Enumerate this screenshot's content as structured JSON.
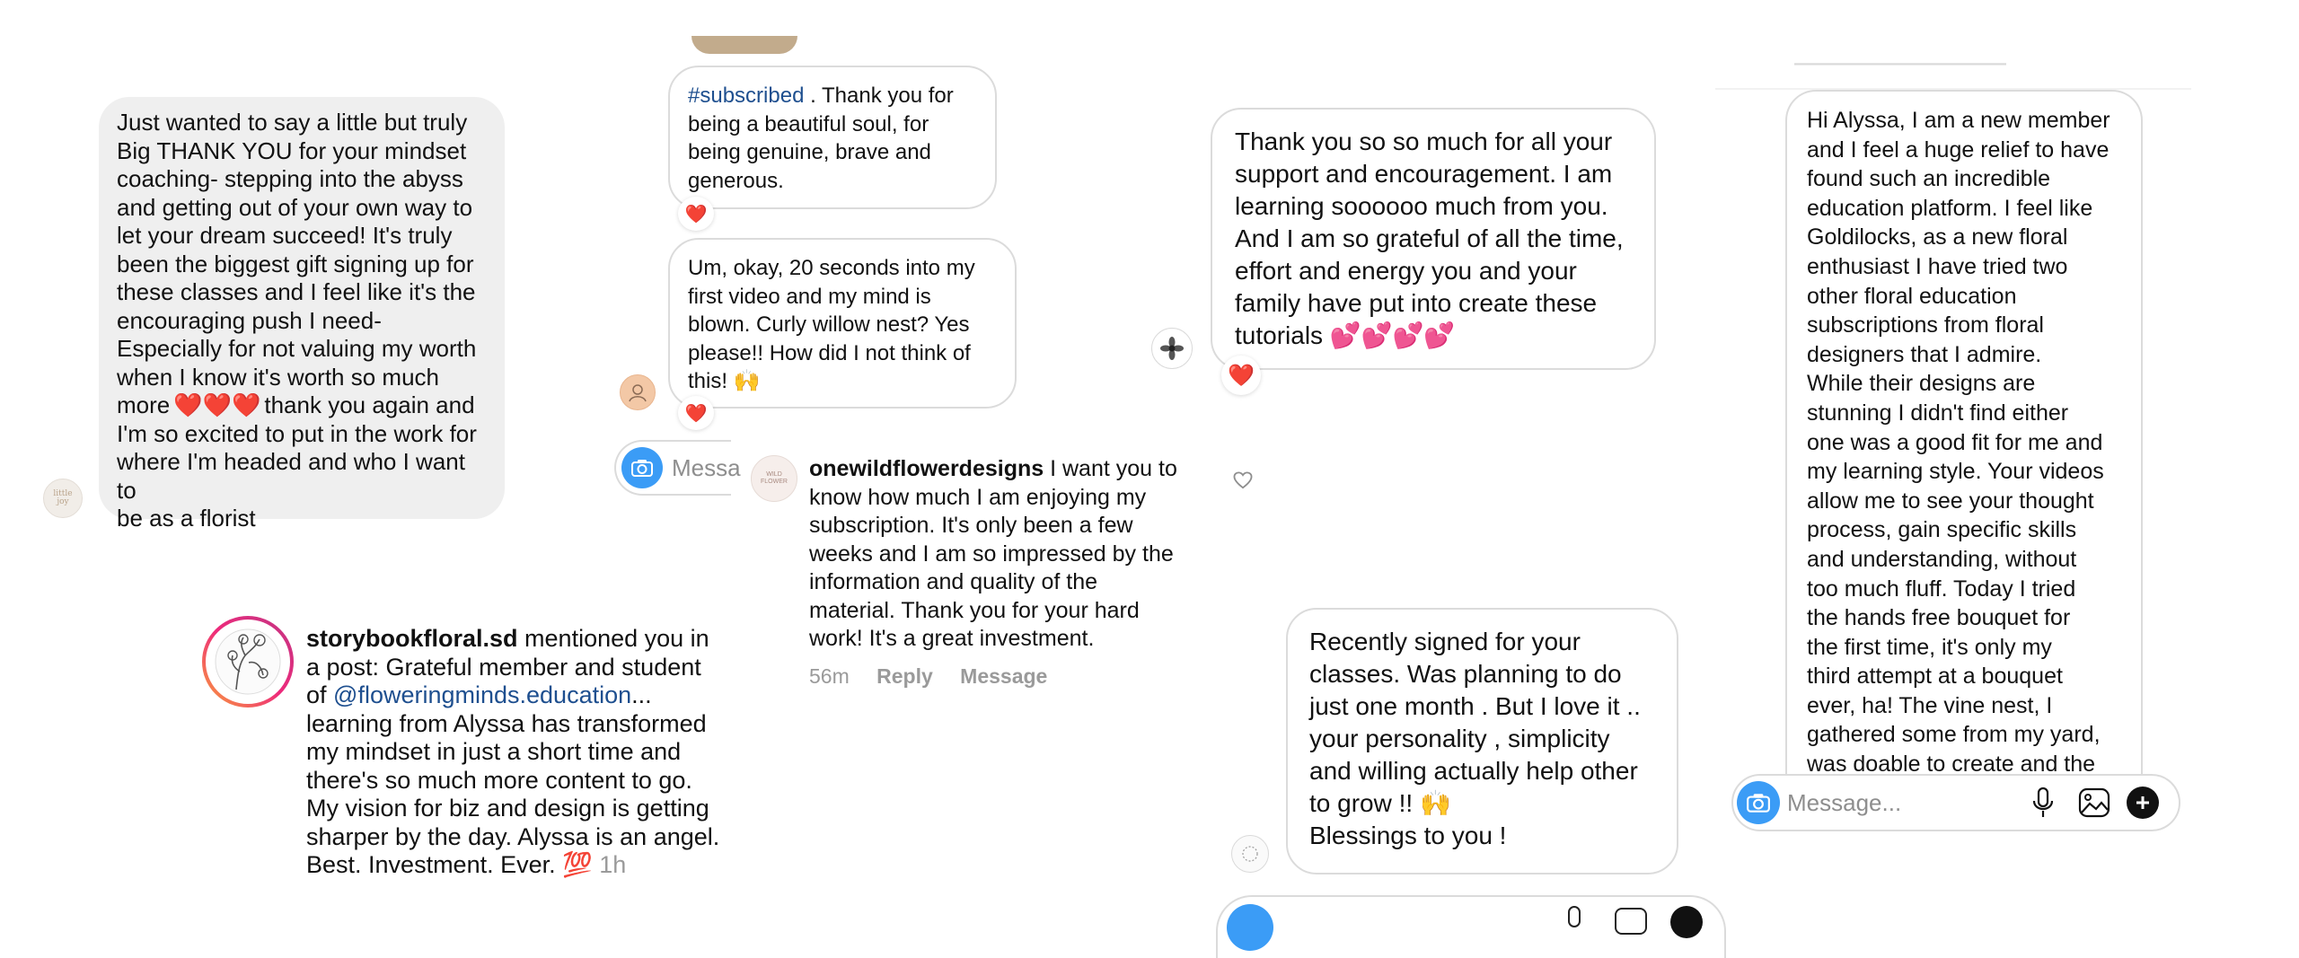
{
  "colors": {
    "gray_bubble": "#efefef",
    "bubble_border": "#dbdbdb",
    "link": "#1e4f8f",
    "heart": "#ed1c3a",
    "camera_button": "#3b9cf6",
    "muted": "#9a9a9a"
  },
  "panel1": {
    "avatar_text": "little joy",
    "lines": [
      "Just wanted to say a little but truly",
      "Big THANK YOU for your mindset",
      "coaching- stepping into the abyss",
      "and getting out of your own way to",
      "let your dream succeed! It's truly",
      "been the biggest gift signing up for",
      "these classes and I feel like it's the",
      "encouraging push I need-",
      "Especially for not valuing my worth",
      "when I know it's worth so much",
      "more",
      "thank you again and",
      "I'm so excited to put in the work for",
      "where I'm headed and who I want to",
      "be as a florist"
    ],
    "hearts": "❤️❤️❤️"
  },
  "panel2": {
    "hashtag": "#subscribed",
    "msg1_rest": " . Thank you for",
    "msg1_lines": [
      "being a beautiful soul, for",
      "being genuine, brave and",
      "generous."
    ],
    "msg2_lines": [
      "Um, okay, 20 seconds into my",
      "first video and my mind is",
      "blown. Curly willow nest? Yes",
      "please!! How did I not think of",
      "this!"
    ],
    "msg2_emoji": "🙌",
    "reaction_heart": "❤️",
    "input_placeholder": "Messa"
  },
  "panel3": {
    "username": "storybookfloral.sd",
    "intro": " mentioned you in",
    "line2": "a post: Grateful member and student",
    "line3_prefix": "of ",
    "mention": "@floweringminds.education",
    "ellipsis": "...",
    "lines": [
      "learning from Alyssa has transformed",
      "my mindset in just a short time and",
      "there's so much more content to go.",
      "My vision for biz and design is getting",
      "sharper by the day. Alyssa is an angel."
    ],
    "last_line": "Best. Investment. Ever.",
    "emoji": "💯",
    "time": "1h"
  },
  "panel4": {
    "username": "onewildflowerdesigns",
    "avatar_text": "WILD FLOWER",
    "first_line_rest": " I want you to",
    "lines": [
      "know how much I am enjoying my",
      "subscription. It's only been a few",
      "weeks and I am so impressed by the",
      "information and quality of the",
      "material. Thank you for your hard",
      "work!  It's a great investment."
    ],
    "time": "56m",
    "reply": "Reply",
    "message": "Message",
    "like_icon": "heart-outline-icon"
  },
  "panel5": {
    "lines": [
      "Thank you so so much for all your",
      "support and encouragement. I am",
      "learning soooooo much from you.",
      "And I am so grateful of all the time,",
      "effort and energy you and your",
      "family have put into create these",
      "tutorials"
    ],
    "emoji": "💕💕💕💕",
    "reaction_heart": "❤️"
  },
  "panel6": {
    "lines": [
      "Recently signed for your",
      "classes. Was planning to do",
      "just one month . But I love it ..",
      "your personality , simplicity",
      "and willing actually help other",
      "to grow !!"
    ],
    "emoji": "🙌",
    "last_line": "Blessings to you !"
  },
  "panel7": {
    "lines": [
      "Hi Alyssa, I am a new member",
      "and I feel a huge relief to have",
      "found such an incredible",
      "education platform. I feel like",
      "Goldilocks, as a new floral",
      "enthusiast I have tried two",
      "other floral education",
      "subscriptions from floral",
      "designers that I admire.",
      "While their designs are",
      "stunning I didn't find either",
      "one was a good fit for me and",
      "my learning style. Your videos",
      "allow me to see your thought",
      "process, gain specific skills",
      "and understanding, without",
      "too much fluff.  Today I tried",
      "the hands free bouquet for",
      "the first time, it's only my",
      "third attempt at a bouquet",
      "ever, ha! The vine nest, I",
      "gathered some from my yard,",
      "was doable to create and the"
    ],
    "input_placeholder": "Message...",
    "icons": [
      "microphone-icon",
      "image-icon",
      "plus-icon"
    ]
  }
}
